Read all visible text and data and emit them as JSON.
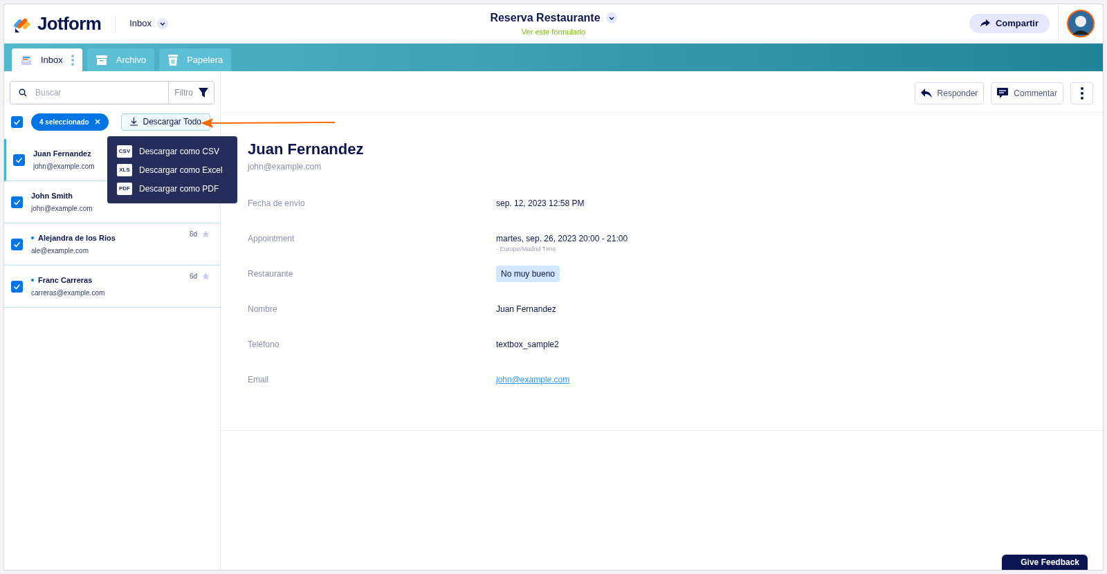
{
  "header": {
    "brand": "Jotform",
    "section": "Inbox",
    "form_title": "Reserva Restaurante",
    "form_link": "Ver este formulario",
    "share_button": "Compartir"
  },
  "tabs": [
    {
      "label": "Inbox",
      "kind": "inbox",
      "selected": true
    },
    {
      "label": "Archivo",
      "kind": "archive",
      "selected": false
    },
    {
      "label": "Papelera",
      "kind": "trash",
      "selected": false
    }
  ],
  "search": {
    "placeholder": "Buscar",
    "filter_button": "Filtro"
  },
  "selection": {
    "checked": true,
    "chip": "4 seleccionado",
    "download_button": "Descargar Todo"
  },
  "download_menu": [
    {
      "label": "Descargar como CSV",
      "file_type": "CSV"
    },
    {
      "label": "Descargar como Excel",
      "file_type": "XLS"
    },
    {
      "label": "Descargar como PDF",
      "file_type": "PDF"
    }
  ],
  "submissions": [
    {
      "name": "Juan Fernandez",
      "email": "john@example.com",
      "checked": true,
      "selected": true,
      "unread": false
    },
    {
      "name": "John Smith",
      "email": "john@example.com",
      "checked": true,
      "selected": false,
      "unread": false
    },
    {
      "name": "Alejandra de los Rios",
      "email": "ale@example.com",
      "checked": true,
      "selected": false,
      "unread": true,
      "age": "6d",
      "starred": false
    },
    {
      "name": "Franc Carreras",
      "email": "carreras@example.com",
      "checked": true,
      "selected": false,
      "unread": true,
      "age": "6d",
      "starred": false
    }
  ],
  "toolbar": {
    "reply_button": "Responder",
    "comment_button": "Commentar"
  },
  "detail": {
    "name": "Juan Fernandez",
    "email": "john@example.com",
    "fields": [
      {
        "label": "Fecha de envío",
        "kind": "text",
        "value": "sep. 12, 2023 12:58 PM"
      },
      {
        "label": "Appointment",
        "kind": "text",
        "value": "martes, sep. 26, 2023 20:00 - 21:00",
        "note": "- Europe/Madrid Time"
      },
      {
        "label": "Restaurante",
        "kind": "tag",
        "value": "No muy bueno"
      },
      {
        "label": "Nombre",
        "kind": "text",
        "value": "Juan Fernandez"
      },
      {
        "label": "Teléfono",
        "kind": "text",
        "value": "textbox_sample2"
      },
      {
        "label": "Email",
        "kind": "link",
        "value": "john@example.com"
      }
    ]
  },
  "feedback_button": "Give Feedback"
}
